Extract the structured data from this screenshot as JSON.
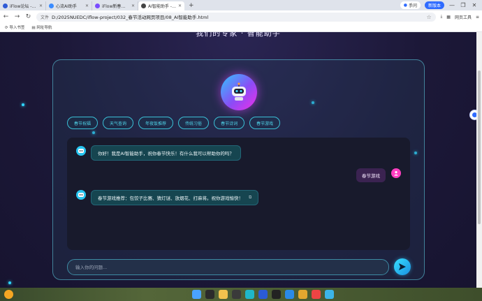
{
  "browser": {
    "tabs": [
      {
        "title": "iFlow论坛 - 粤智AI",
        "color": "#2f5bd6"
      },
      {
        "title": "心流AI助手",
        "color": "#3a8bff"
      },
      {
        "title": "iFlow新春双活动上...",
        "color": "#7a4cff"
      },
      {
        "title": "AI智能助手 - ...",
        "color": "#444",
        "active": true
      }
    ],
    "new_tab": "+",
    "right_pill": "手问",
    "login_pill": "新版本",
    "address_label": "文件",
    "url": "D:/2025NUEDC/iflow-project/032_春节活动网页项目/08_AI智能助手.html",
    "tools_label": "网页工具",
    "bookmarks": [
      "导入书签",
      "网址导航"
    ]
  },
  "page": {
    "title": "我们的专家 · 智能助手"
  },
  "chips": [
    "春节祝福",
    "天气查询",
    "年夜饭推荐",
    "传统习俗",
    "春节诗词",
    "春节游戏"
  ],
  "messages": {
    "bot_greeting": "你好！我是AI智能助手，祝你春节快乐！有什么我可以帮助你的吗？",
    "user_msg": "春节游戏",
    "bot_reply": "春节游戏推荐：包饺子比赛、猜灯谜、放烟花、打麻将。祝你游戏愉快！"
  },
  "input": {
    "placeholder": "输入你的问题..."
  },
  "colors": {
    "accent": "#2fd6ff",
    "user_avatar": "#ff3ec1",
    "bot_avatar": "#27c4ef"
  }
}
